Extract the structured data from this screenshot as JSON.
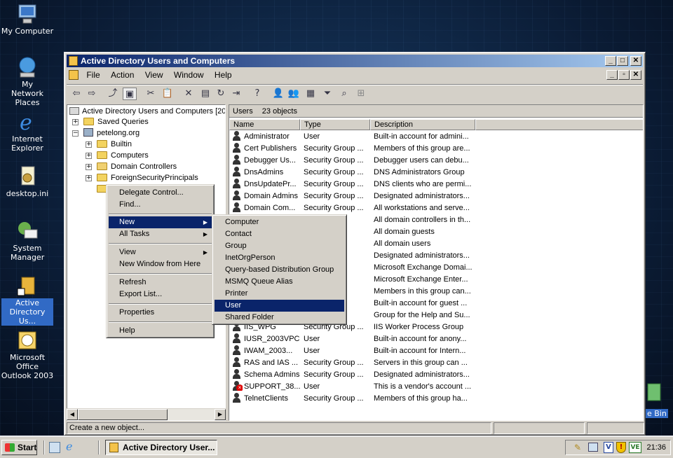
{
  "desktop": {
    "icons": [
      {
        "label": "My Computer"
      },
      {
        "label": "My Network Places"
      },
      {
        "label": "Internet Explorer"
      },
      {
        "label": "desktop.ini"
      },
      {
        "label": "System Manager"
      },
      {
        "label": "Active Directory Us..."
      },
      {
        "label": "Microsoft Office Outlook 2003"
      }
    ],
    "recycle_bin_label": "e Bin"
  },
  "window": {
    "title": "Active Directory Users and Computers",
    "menu": [
      "File",
      "Action",
      "View",
      "Window",
      "Help"
    ]
  },
  "tree": {
    "root": "Active Directory Users and Computers [20",
    "saved_queries": "Saved Queries",
    "domain": "petelong.org",
    "children": [
      "Builtin",
      "Computers",
      "Domain Controllers",
      "ForeignSecurityPrincipals"
    ]
  },
  "list": {
    "header": "Users",
    "count": "23 objects",
    "columns": [
      "Name",
      "Type",
      "Description"
    ],
    "rows": [
      {
        "name": "Administrator",
        "type": "User",
        "desc": "Built-in account for admini..."
      },
      {
        "name": "Cert Publishers",
        "type": "Security Group ...",
        "desc": "Members of this group are..."
      },
      {
        "name": "Debugger Us...",
        "type": "Security Group ...",
        "desc": "Debugger users can debu..."
      },
      {
        "name": "DnsAdmins",
        "type": "Security Group ...",
        "desc": "DNS Administrators Group"
      },
      {
        "name": "DnsUpdatePr...",
        "type": "Security Group ...",
        "desc": "DNS clients who are permi..."
      },
      {
        "name": "Domain Admins",
        "type": "Security Group ...",
        "desc": "Designated administrators..."
      },
      {
        "name": "Domain Com...",
        "type": "Security Group ...",
        "desc": "All workstations and serve..."
      },
      {
        "name": "",
        "type": "",
        "desc": "All domain controllers in th..."
      },
      {
        "name": "",
        "type": "",
        "desc": "All domain guests"
      },
      {
        "name": "",
        "type": "",
        "desc": "All domain users"
      },
      {
        "name": "",
        "type": "",
        "desc": "Designated administrators..."
      },
      {
        "name": "",
        "type": "",
        "desc": "Microsoft Exchange Domai..."
      },
      {
        "name": "",
        "type": "",
        "desc": "Microsoft Exchange Enter..."
      },
      {
        "name": "",
        "type": "",
        "desc": "Members in this group can..."
      },
      {
        "name": "",
        "type": "",
        "desc": "Built-in account for guest ..."
      },
      {
        "name": "",
        "type": "",
        "desc": "Group for the Help and Su..."
      },
      {
        "name": "IIS_WPG",
        "type": "Security Group ...",
        "desc": "IIS Worker Process Group"
      },
      {
        "name": "IUSR_2003VPC",
        "type": "User",
        "desc": "Built-in account for anony..."
      },
      {
        "name": "IWAM_2003...",
        "type": "User",
        "desc": "Built-in account for Intern..."
      },
      {
        "name": "RAS and IAS ...",
        "type": "Security Group ...",
        "desc": "Servers in this group can ..."
      },
      {
        "name": "Schema Admins",
        "type": "Security Group ...",
        "desc": "Designated administrators..."
      },
      {
        "name": "SUPPORT_38...",
        "type": "User",
        "desc": "This is a vendor's account ..."
      },
      {
        "name": "TelnetClients",
        "type": "Security Group ...",
        "desc": "Members of this group ha..."
      }
    ]
  },
  "context_menu": {
    "items": [
      "Delegate Control...",
      "Find...",
      "New",
      "All Tasks",
      "View",
      "New Window from Here",
      "Refresh",
      "Export List...",
      "Properties",
      "Help"
    ],
    "highlighted": "New"
  },
  "submenu": {
    "items": [
      "Computer",
      "Contact",
      "Group",
      "InetOrgPerson",
      "Query-based Distribution Group",
      "MSMQ Queue Alias",
      "Printer",
      "User",
      "Shared Folder"
    ],
    "highlighted": "User"
  },
  "status": {
    "text": "Create a new object..."
  },
  "taskbar": {
    "start_label": "Start",
    "task_label": "Active Directory User...",
    "clock": "21:36"
  }
}
